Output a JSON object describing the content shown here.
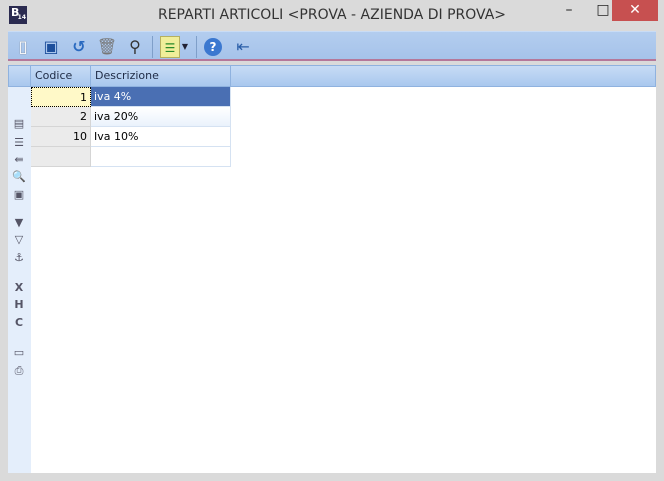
{
  "window": {
    "title": "REPARTI ARTICOLI <PROVA - AZIENDA DI PROVA>",
    "app_icon": "B",
    "app_icon_sub": "14",
    "minimize": "–",
    "maximize": "□",
    "close": "✕"
  },
  "toolbar": [
    "new-icon",
    "save-icon",
    "undo-icon",
    "delete-icon",
    "search-icon",
    "list-options-icon",
    "help-icon",
    "exit-icon"
  ],
  "grid": {
    "columns": [
      "Codice",
      "Descrizione"
    ],
    "rows": [
      {
        "codice": "1",
        "descrizione": "iva 4%"
      },
      {
        "codice": "2",
        "descrizione": "iva 20%"
      },
      {
        "codice": "10",
        "descrizione": "Iva 10%"
      }
    ]
  },
  "colors": {
    "selection": "#4a6fb3",
    "close": "#c75050"
  }
}
